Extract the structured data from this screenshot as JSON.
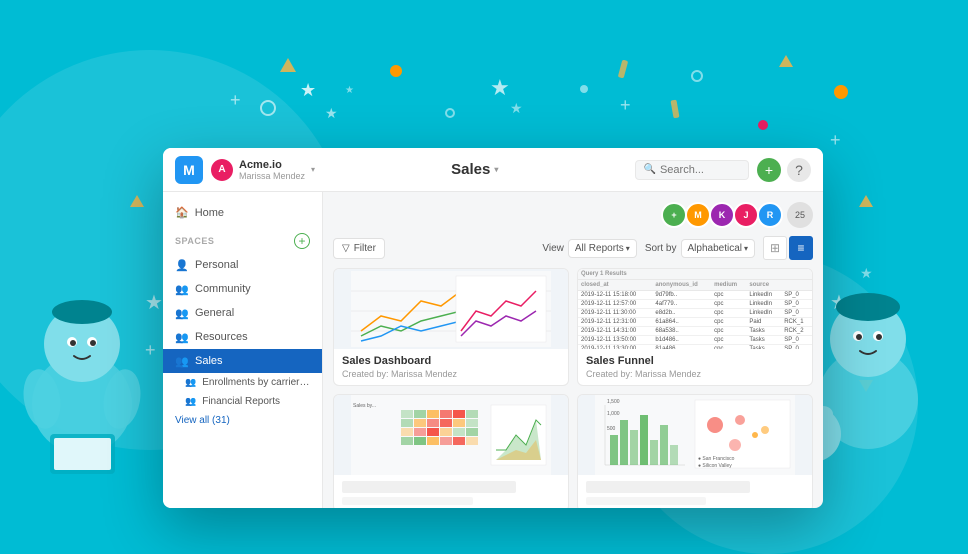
{
  "app": {
    "logo_letter": "M",
    "workspace_name": "Acme.io",
    "workspace_user": "Marissa Mendez",
    "workspace_avatar_letter": "A",
    "title": "Sales",
    "search_placeholder": "Search...",
    "add_button_label": "+",
    "help_button_label": "?"
  },
  "sidebar": {
    "home_label": "Home",
    "spaces_label": "SPACES",
    "items": [
      {
        "id": "personal",
        "label": "Personal",
        "icon": "👤"
      },
      {
        "id": "community",
        "label": "Community",
        "icon": "👥"
      },
      {
        "id": "general",
        "label": "General",
        "icon": "👥"
      },
      {
        "id": "resources",
        "label": "Resources",
        "icon": "👥"
      },
      {
        "id": "sales",
        "label": "Sales",
        "icon": "👥",
        "active": true
      }
    ],
    "sub_items": [
      {
        "label": "Enrollments by carrier for AD a..."
      },
      {
        "label": "Financial Reports"
      }
    ],
    "view_all": "View all (31)"
  },
  "toolbar": {
    "filter_label": "Filter",
    "view_label": "View",
    "view_value": "All Reports",
    "sort_label": "Sort by",
    "sort_value": "Alphabetical"
  },
  "avatars": [
    {
      "color": "#4CAF50",
      "letter": "+"
    },
    {
      "color": "#FF9800",
      "letter": "M"
    },
    {
      "color": "#9C27B0",
      "letter": "K"
    },
    {
      "color": "#E91E63",
      "letter": "J"
    },
    {
      "color": "#2196F3",
      "letter": "R"
    },
    {
      "count": "25"
    }
  ],
  "cards": [
    {
      "id": "sales-dashboard",
      "title": "Sales Dashboard",
      "subtitle": "Created by: Marissa Mendez",
      "type": "line-chart"
    },
    {
      "id": "sales-funnel",
      "title": "Sales Funnel",
      "subtitle": "Created by: Marissa Mendez",
      "type": "table"
    },
    {
      "id": "card3",
      "title": "",
      "subtitle": "",
      "type": "bar-chart"
    },
    {
      "id": "card4",
      "title": "",
      "subtitle": "",
      "type": "scatter"
    }
  ]
}
